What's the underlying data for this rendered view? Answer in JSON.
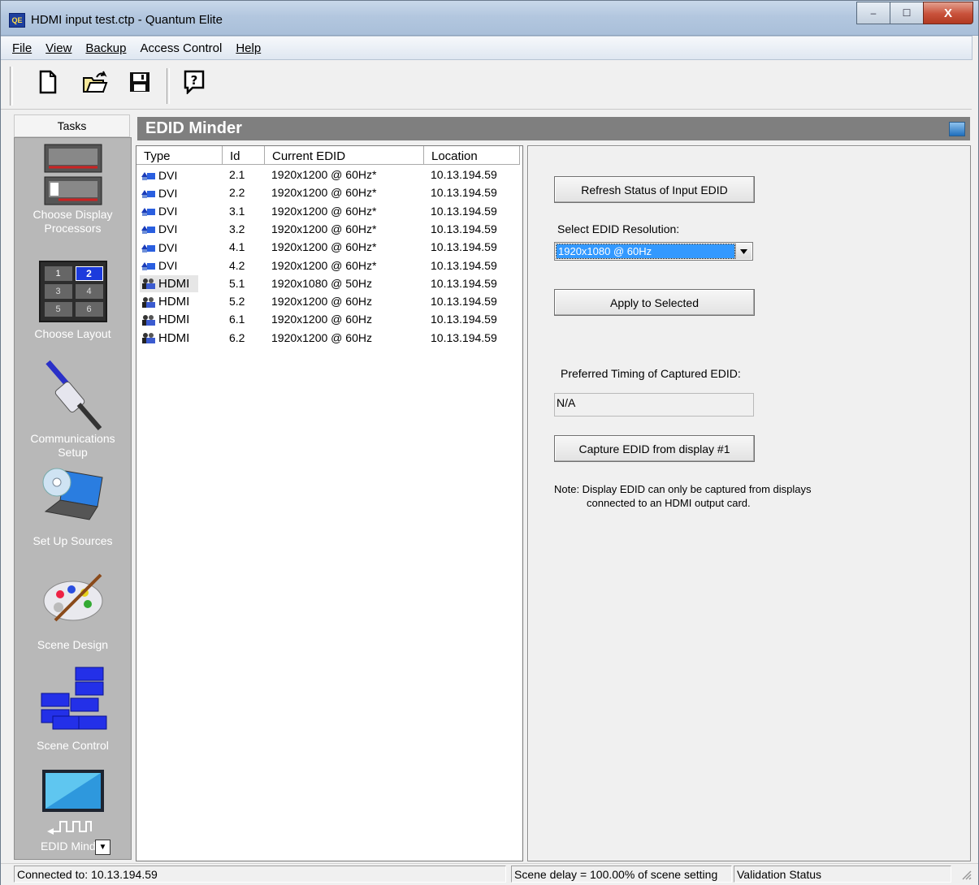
{
  "window": {
    "app_icon": "QE",
    "title": "HDMI input test.ctp - Quantum Elite",
    "controls": {
      "minimize": "–",
      "maximize": "☐",
      "close": "X"
    }
  },
  "menu": [
    {
      "label": "File"
    },
    {
      "label": "View"
    },
    {
      "label": "Backup"
    },
    {
      "label": "Access Control"
    },
    {
      "label": "Help"
    }
  ],
  "toolbar": {
    "icons": [
      "new-document-icon",
      "open-folder-icon",
      "save-disk-icon",
      "help-icon"
    ]
  },
  "tasks": {
    "header": "Tasks",
    "items": [
      {
        "label1": "Choose Display",
        "label2": "Processors",
        "icon": "display-processors-icon"
      },
      {
        "label1": "Choose Layout",
        "icon": "layout-grid-icon",
        "grid": [
          "1",
          "2",
          "3",
          "4",
          "5",
          "6"
        ]
      },
      {
        "label1": "Communications Setup",
        "icon": "communications-plug-icon"
      },
      {
        "label1": "Set Up Sources",
        "icon": "sources-laptop-icon"
      },
      {
        "label1": "Scene Design",
        "icon": "palette-icon"
      },
      {
        "label1": "Scene Control",
        "icon": "scene-windows-icon"
      },
      {
        "label1": "EDID Minder",
        "icon": "edid-monitor-icon"
      }
    ]
  },
  "main": {
    "title": "EDID Minder",
    "columns": [
      "Type",
      "Id",
      "Current EDID",
      "Location"
    ],
    "rows": [
      {
        "type": "DVI",
        "id": "2.1",
        "edid": "1920x1200 @ 60Hz*",
        "location": "10.13.194.59",
        "icon": "dvi-icon"
      },
      {
        "type": "DVI",
        "id": "2.2",
        "edid": "1920x1200 @ 60Hz*",
        "location": "10.13.194.59",
        "icon": "dvi-icon"
      },
      {
        "type": "DVI",
        "id": "3.1",
        "edid": "1920x1200 @ 60Hz*",
        "location": "10.13.194.59",
        "icon": "dvi-icon"
      },
      {
        "type": "DVI",
        "id": "3.2",
        "edid": "1920x1200 @ 60Hz*",
        "location": "10.13.194.59",
        "icon": "dvi-icon"
      },
      {
        "type": "DVI",
        "id": "4.1",
        "edid": "1920x1200 @ 60Hz*",
        "location": "10.13.194.59",
        "icon": "dvi-icon"
      },
      {
        "type": "DVI",
        "id": "4.2",
        "edid": "1920x1200 @ 60Hz*",
        "location": "10.13.194.59",
        "icon": "dvi-icon"
      },
      {
        "type": "HDMI",
        "id": "5.1",
        "edid": "1920x1080 @ 50Hz",
        "location": "10.13.194.59",
        "icon": "hdmi-icon",
        "selected": true
      },
      {
        "type": "HDMI",
        "id": "5.2",
        "edid": "1920x1200 @ 60Hz",
        "location": "10.13.194.59",
        "icon": "hdmi-icon"
      },
      {
        "type": "HDMI",
        "id": "6.1",
        "edid": "1920x1200 @ 60Hz",
        "location": "10.13.194.59",
        "icon": "hdmi-icon"
      },
      {
        "type": "HDMI",
        "id": "6.2",
        "edid": "1920x1200 @ 60Hz",
        "location": "10.13.194.59",
        "icon": "hdmi-icon"
      }
    ]
  },
  "panel": {
    "refresh_button": "Refresh Status of Input EDID",
    "select_label": "Select EDID Resolution:",
    "select_value": "1920x1080 @ 60Hz",
    "apply_button": "Apply to Selected",
    "preferred_label": "Preferred Timing of Captured EDID:",
    "preferred_value": "N/A",
    "capture_button": "Capture EDID from display #1",
    "note_line1": "Note: Display EDID can only be captured from displays",
    "note_line2": "connected to an HDMI output card."
  },
  "status": {
    "connected": "Connected to: 10.13.194.59",
    "scene_delay": "Scene delay = 100.00% of scene setting",
    "validation": "Validation Status"
  }
}
